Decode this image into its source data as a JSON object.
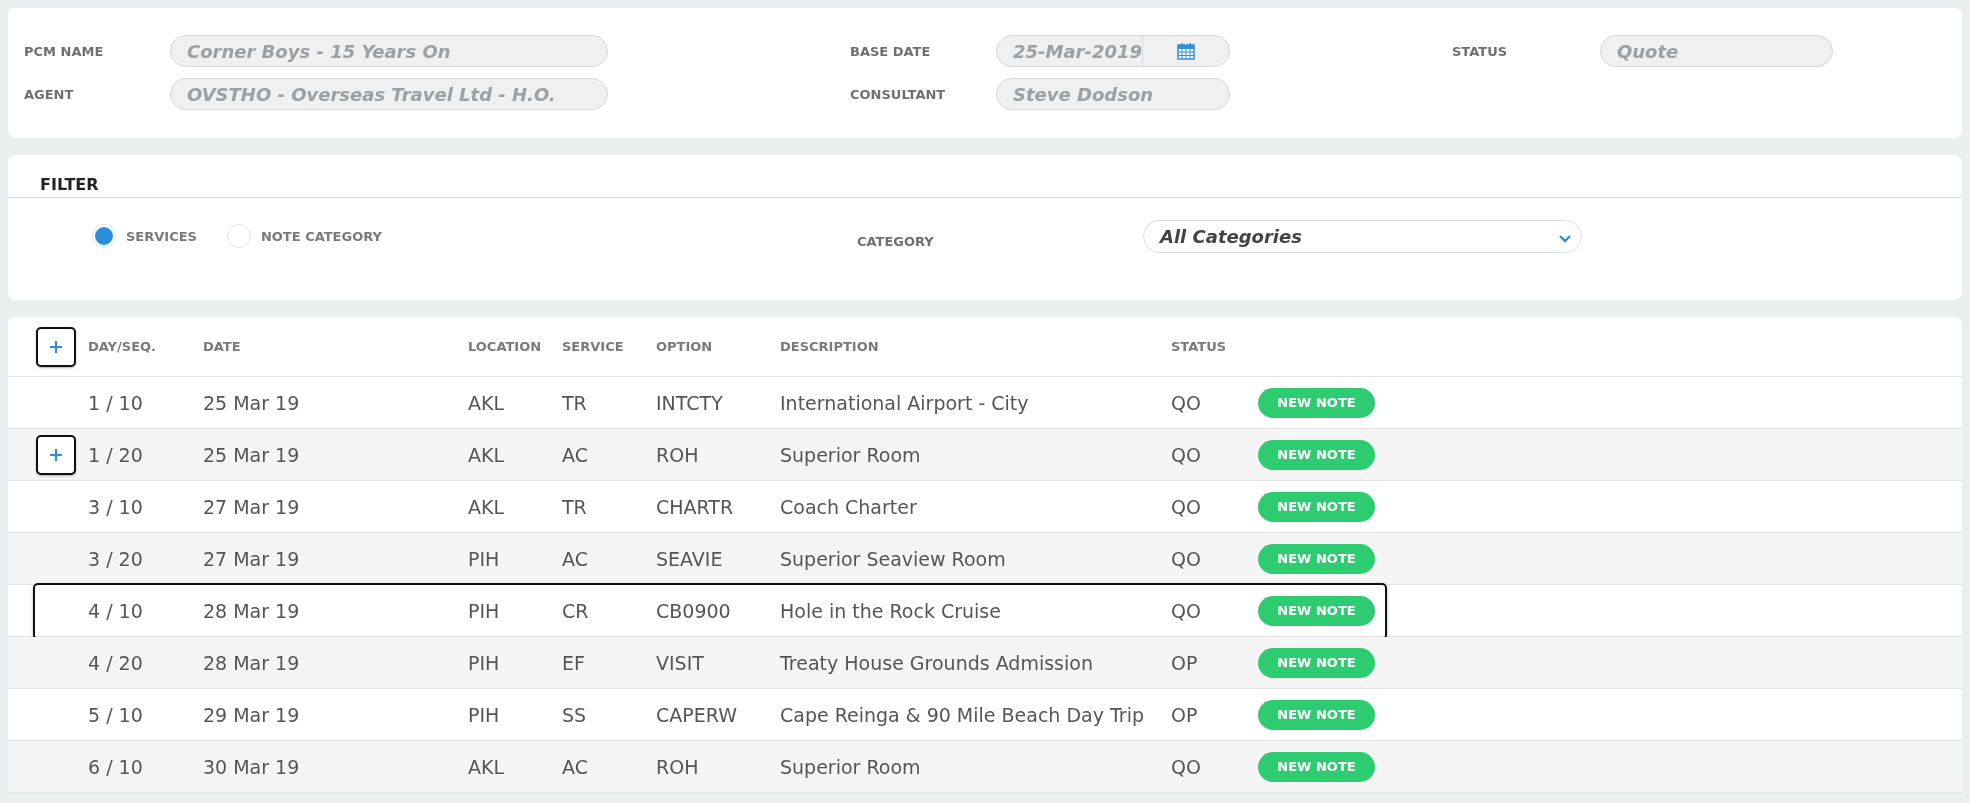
{
  "header": {
    "rows": [
      [
        {
          "label": "PCM NAME",
          "value": "Corner Boys - 15 Years On",
          "kind": "text"
        },
        {
          "label": "BASE DATE",
          "value": "25-Mar-2019",
          "kind": "date"
        },
        {
          "label": "STATUS",
          "value": "Quote",
          "kind": "text"
        }
      ],
      [
        {
          "label": "AGENT",
          "value": "OVSTHO - Overseas Travel Ltd - H.O.",
          "kind": "text"
        },
        {
          "label": "CONSULTANT",
          "value": "Steve Dodson",
          "kind": "text"
        }
      ]
    ]
  },
  "filter": {
    "title": "FILTER",
    "options": [
      {
        "label": "SERVICES",
        "selected": true
      },
      {
        "label": "NOTE CATEGORY",
        "selected": false
      }
    ],
    "category": {
      "label": "CATEGORY",
      "value": "All Categories"
    }
  },
  "table": {
    "add_button": true,
    "columns": [
      "DAY/SEQ.",
      "DATE",
      "LOCATION",
      "SERVICE",
      "OPTION",
      "DESCRIPTION",
      "STATUS"
    ],
    "rows": [
      {
        "cells": [
          "1 / 10",
          "25 Mar 19",
          "AKL",
          "TR",
          "INTCTY",
          "International Airport - City",
          "QO"
        ],
        "note_button": "NEW NOTE",
        "add_button": false,
        "highlighted": false
      },
      {
        "cells": [
          "1 / 20",
          "25 Mar 19",
          "AKL",
          "AC",
          "ROH",
          "Superior Room",
          "QO"
        ],
        "note_button": "NEW NOTE",
        "add_button": true,
        "highlighted": false
      },
      {
        "cells": [
          "3 / 10",
          "27 Mar 19",
          "AKL",
          "TR",
          "CHARTR",
          "Coach Charter",
          "QO"
        ],
        "note_button": "NEW NOTE",
        "add_button": false,
        "highlighted": false
      },
      {
        "cells": [
          "3 / 20",
          "27 Mar 19",
          "PIH",
          "AC",
          "SEAVIE",
          "Superior Seaview Room",
          "QO"
        ],
        "note_button": "NEW NOTE",
        "add_button": false,
        "highlighted": false
      },
      {
        "cells": [
          "4 / 10",
          "28 Mar 19",
          "PIH",
          "CR",
          "CB0900",
          "Hole in the Rock Cruise",
          "QO"
        ],
        "note_button": "NEW NOTE",
        "add_button": false,
        "highlighted": true
      },
      {
        "cells": [
          "4 / 20",
          "28 Mar 19",
          "PIH",
          "EF",
          "VISIT",
          "Treaty House Grounds Admission",
          "OP"
        ],
        "note_button": "NEW NOTE",
        "add_button": false,
        "highlighted": false
      },
      {
        "cells": [
          "5 / 10",
          "29 Mar 19",
          "PIH",
          "SS",
          "CAPERW",
          "Cape Reinga & 90 Mile Beach Day Trip",
          "OP"
        ],
        "note_button": "NEW NOTE",
        "add_button": false,
        "highlighted": false
      },
      {
        "cells": [
          "6 / 10",
          "30 Mar 19",
          "AKL",
          "AC",
          "ROH",
          "Superior Room",
          "QO"
        ],
        "note_button": "NEW NOTE",
        "add_button": false,
        "highlighted": false
      }
    ]
  }
}
